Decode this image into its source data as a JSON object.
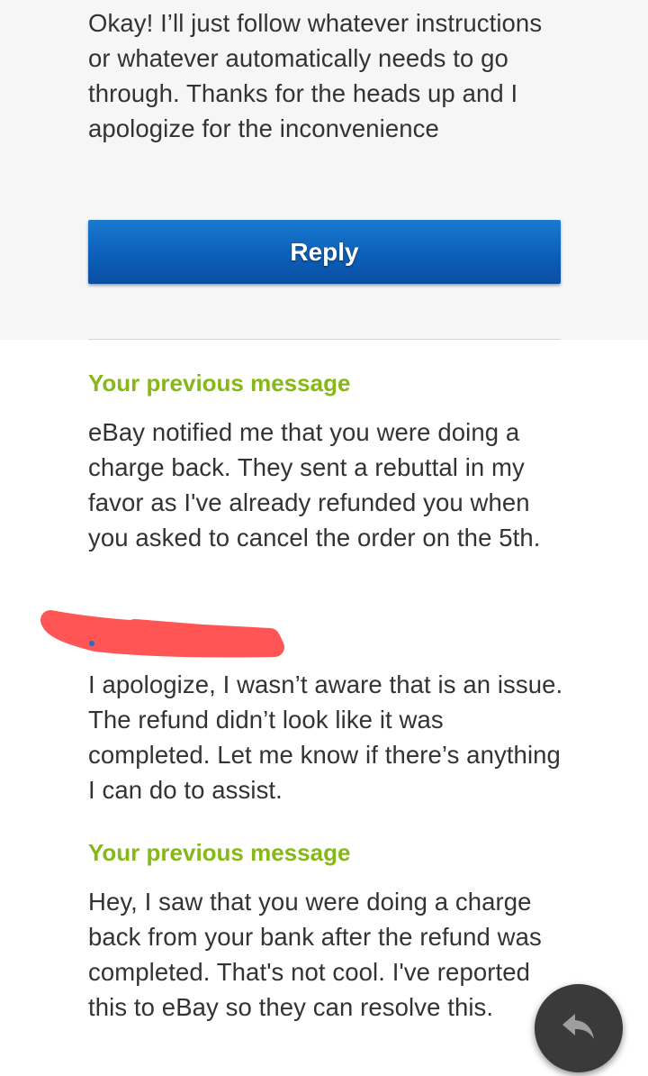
{
  "messages": {
    "received_top": "Okay! I’ll just follow whatever instructions or whatever automatically needs to go through. Thanks for the heads up and I apologize for the inconvenience",
    "reply_label": "Reply",
    "previous_1": {
      "label": "Your previous message",
      "text": "eBay notified me that you were doing a charge back. They sent a rebuttal in my favor as I've already refunded you when you asked to cancel the order on the 5th."
    },
    "received_middle": "I apologize, I wasn’t aware that is an issue. The refund didn’t look like it was completed. Let me know if there’s anything I can do to assist.",
    "previous_2": {
      "label": "Your previous message",
      "text": "Hey, I saw that you were doing a charge back from your bank after the refund was completed. That's not cool. I've reported this to eBay so they can resolve this."
    }
  },
  "icons": {
    "fab": "reply-arrow-icon"
  },
  "colors": {
    "accent_green": "#86b817",
    "button_blue": "#0c5fb8",
    "redaction_red": "#ff5555",
    "fab_bg": "#3a3a3a"
  }
}
